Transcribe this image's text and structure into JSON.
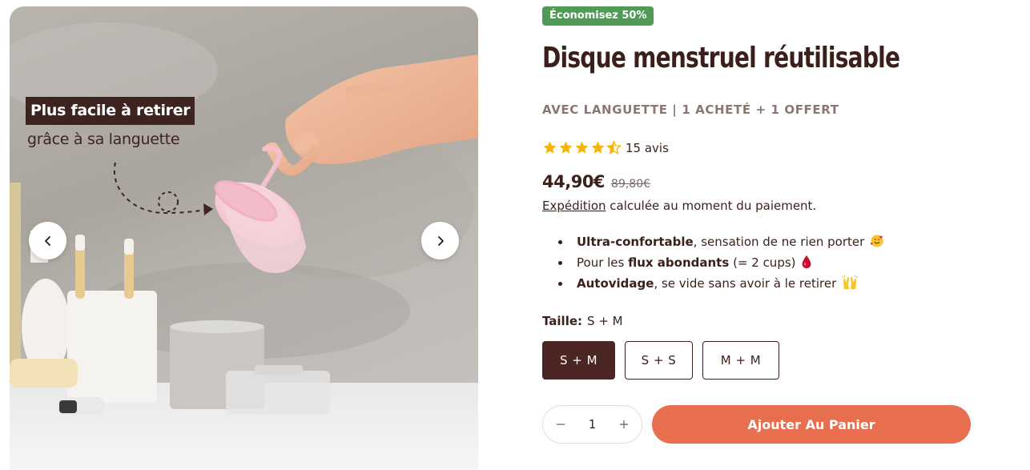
{
  "gallery": {
    "overlay_title": "Plus facile à retirer",
    "overlay_subtitle": "grâce à sa languette"
  },
  "product": {
    "badge": "Économisez 50%",
    "title": "Disque menstruel réutilisable",
    "subtitle": "AVEC LANGUETTE | 1 ACHETÉ + 1 OFFERT",
    "rating": {
      "value": 4.5,
      "max": 5,
      "reviews": "15 avis",
      "star_color": "#f4b400"
    },
    "price": "44,90€",
    "compare_price": "89,80€",
    "shipping_link": "Expédition",
    "shipping_text": " calculée au moment du paiement.",
    "features": [
      {
        "bold": "Ultra-confortable",
        "rest": ", sensation de ne rien porter",
        "icon": "smiling-face-with-hearts-icon"
      },
      {
        "pre": "Pour les ",
        "bold": "flux abondants",
        "rest": " (= 2 cups)",
        "icon": "drop-of-blood-icon"
      },
      {
        "bold": "Autovidage",
        "rest": ", se vide sans avoir à le retirer",
        "icon": "raising-hands-icon"
      }
    ],
    "size": {
      "label": "Taille:",
      "selected": "S + M",
      "options": [
        "S + M",
        "S + S",
        "M + M"
      ]
    },
    "quantity": "1",
    "add_to_cart": "Ajouter Au Panier"
  },
  "colors": {
    "accent": "#e76f50",
    "brand_dark": "#4a2521",
    "badge_green": "#4f9a55"
  }
}
